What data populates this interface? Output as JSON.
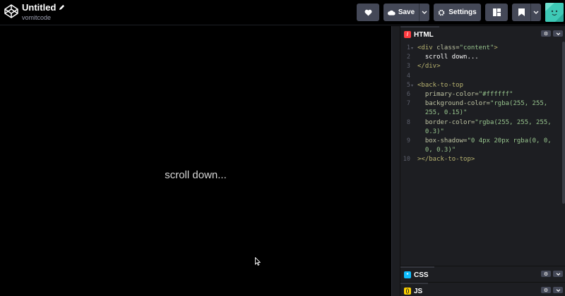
{
  "header": {
    "pen_title": "Untitled",
    "username": "vomitcode",
    "save_label": "Save",
    "settings_label": "Settings"
  },
  "preview": {
    "text": "scroll down..."
  },
  "editors": {
    "html": {
      "label": "HTML",
      "color": "#ff3c41",
      "lines": [
        [
          {
            "c": "tag",
            "t": "<div "
          },
          {
            "c": "attr",
            "t": "class="
          },
          {
            "c": "str",
            "t": "\"content\""
          },
          {
            "c": "tag",
            "t": ">"
          }
        ],
        [
          {
            "c": "txt",
            "t": "  scroll down..."
          }
        ],
        [
          {
            "c": "tag",
            "t": "</div>"
          }
        ],
        [],
        [
          {
            "c": "tag",
            "t": "<back-to-top"
          }
        ],
        [
          {
            "c": "attr",
            "t": "  primary-color="
          },
          {
            "c": "str",
            "t": "\"#ffffff\""
          }
        ],
        [
          {
            "c": "attr",
            "t": "  background-color="
          },
          {
            "c": "str",
            "t": "\"rgba(255, 255,"
          }
        ],
        [
          {
            "c": "str",
            "t": "  255, 0.15)\""
          }
        ],
        [
          {
            "c": "attr",
            "t": "  border-color="
          },
          {
            "c": "str",
            "t": "\"rgba(255, 255, 255,"
          }
        ],
        [
          {
            "c": "str",
            "t": "  0.3)\""
          }
        ],
        [
          {
            "c": "attr",
            "t": "  box-shadow="
          },
          {
            "c": "str",
            "t": "\"0 4px 20px rgba(0, 0,"
          }
        ],
        [
          {
            "c": "str",
            "t": "  0, 0.3)\""
          }
        ],
        [
          {
            "c": "tag",
            "t": "></back-to-top>"
          }
        ]
      ],
      "line_numbers": [
        "1",
        "2",
        "3",
        "4",
        "5",
        "6",
        "7",
        "",
        "8",
        "",
        "9",
        "",
        "10"
      ]
    },
    "css": {
      "label": "CSS",
      "color": "#0ebeff"
    },
    "js": {
      "label": "JS",
      "color": "#fcd000"
    }
  },
  "icons": {
    "logo": "codepen-logo-icon",
    "edit": "pencil-icon",
    "heart": "heart-icon",
    "cloud": "cloud-icon",
    "gear": "gear-icon",
    "layout": "layout-icon",
    "bookmark": "bookmark-icon",
    "caret": "chevron-down-icon",
    "cursor": "mouse-cursor-icon"
  }
}
